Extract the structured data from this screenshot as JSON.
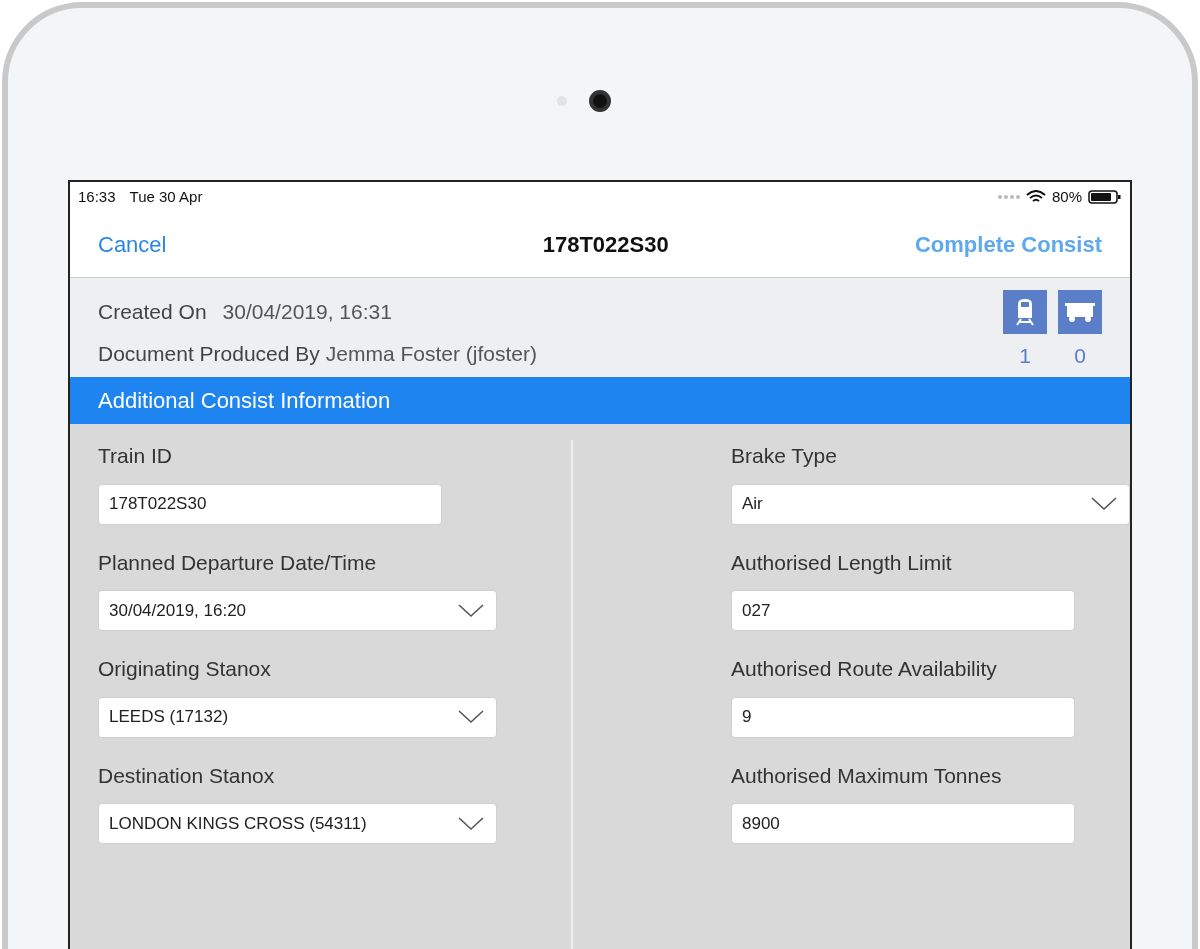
{
  "status_bar": {
    "time": "16:33",
    "date": "Tue 30 Apr",
    "battery": "80%"
  },
  "nav": {
    "cancel": "Cancel",
    "title": "178T022S30",
    "action": "Complete Consist"
  },
  "info": {
    "created_label": "Created On",
    "created_value": "30/04/2019, 16:31",
    "produced_label": "Document Produced By",
    "produced_value": "Jemma Foster (jfoster)"
  },
  "counters": [
    {
      "kind": "locomotive",
      "count": "1"
    },
    {
      "kind": "wagon",
      "count": "0"
    }
  ],
  "section_title": "Additional Consist Information",
  "left_fields": [
    {
      "label": "Train ID",
      "kind": "text",
      "value": "178T022S30"
    },
    {
      "label": "Planned Departure Date/Time",
      "kind": "select",
      "value": "30/04/2019, 16:20"
    },
    {
      "label": "Originating Stanox",
      "kind": "select",
      "value": "LEEDS (17132)"
    },
    {
      "label": "Destination Stanox",
      "kind": "select",
      "value": "LONDON KINGS CROSS (54311)"
    }
  ],
  "right_fields": [
    {
      "label": "Brake Type",
      "kind": "select",
      "value": "Air"
    },
    {
      "label": "Authorised Length Limit",
      "kind": "text",
      "value": "027"
    },
    {
      "label": "Authorised Route Availability",
      "kind": "text",
      "value": "9"
    },
    {
      "label": "Authorised Maximum Tonnes",
      "kind": "text",
      "value": "8900"
    }
  ]
}
